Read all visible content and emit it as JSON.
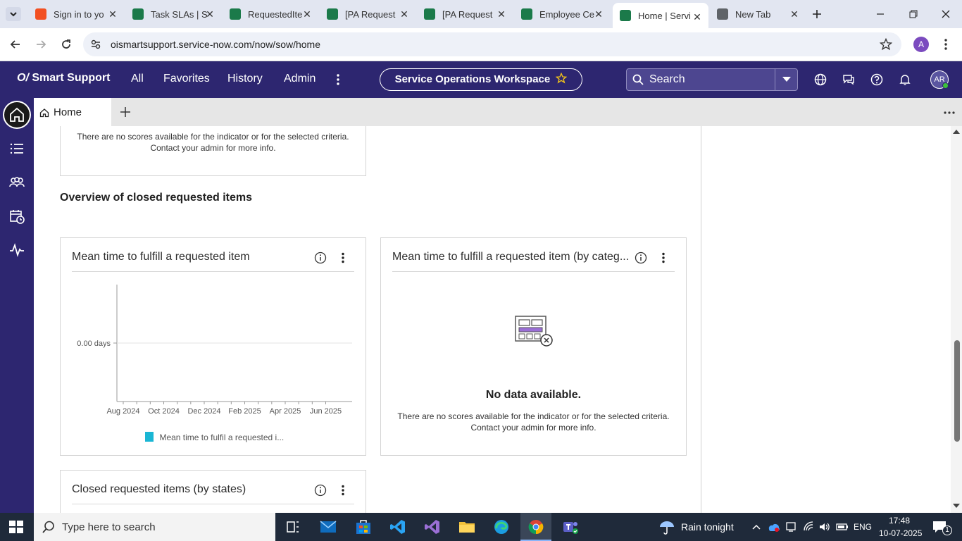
{
  "browser": {
    "tabs": [
      {
        "label": "Sign in to yo",
        "color": "#f25022"
      },
      {
        "label": "Task SLAs | S",
        "color": "#1b7a4a"
      },
      {
        "label": "RequestedIte",
        "color": "#1b7a4a"
      },
      {
        "label": "[PA Request",
        "color": "#1b7a4a"
      },
      {
        "label": "[PA Request",
        "color": "#1b7a4a"
      },
      {
        "label": "Employee Ce",
        "color": "#1b7a4a"
      },
      {
        "label": "Home | Servi",
        "color": "#1b7a4a"
      },
      {
        "label": "New Tab",
        "color": "#5f6368"
      }
    ],
    "url": "oismartsupport.service-now.com/now/sow/home",
    "profile_initial": "A"
  },
  "header": {
    "logo": "Smart Support",
    "nav": [
      "All",
      "Favorites",
      "History",
      "Admin"
    ],
    "workspace": "Service Operations Workspace",
    "search_placeholder": "Search",
    "avatar": "AR",
    "brand_color": "#2d2670"
  },
  "apptabs": {
    "home_label": "Home"
  },
  "main": {
    "top_card": {
      "message_line1": "There are no scores available for the indicator or for the selected criteria.",
      "message_line2": "Contact your admin for more info."
    },
    "section_title": "Overview of closed requested items",
    "card_mean_time": {
      "title": "Mean time to fulfill a requested item",
      "legend": "Mean time to fulfil a requested i..."
    },
    "card_by_category": {
      "title": "Mean time to fulfill a requested item (by categ...",
      "no_data_title": "No data available.",
      "message_line1": "There are no scores available for the indicator or for the selected criteria.",
      "message_line2": "Contact your admin for more info."
    },
    "card_by_states": {
      "title": "Closed requested items (by states)"
    }
  },
  "chart_data": {
    "type": "line",
    "x": [
      "Aug 2024",
      "Oct 2024",
      "Dec 2024",
      "Feb 2025",
      "Apr 2025",
      "Jun 2025"
    ],
    "y_ticks": [
      "0.00 days"
    ],
    "series": [
      {
        "name": "Mean time to fulfil a requested i...",
        "values": [],
        "color": "#1ab6d4"
      }
    ],
    "grid": true,
    "legend": "bottom"
  },
  "taskbar": {
    "search_placeholder": "Type here to search",
    "weather": "Rain tonight",
    "language": "ENG",
    "time": "17:48",
    "date": "10-07-2025",
    "notification_count": "1"
  }
}
